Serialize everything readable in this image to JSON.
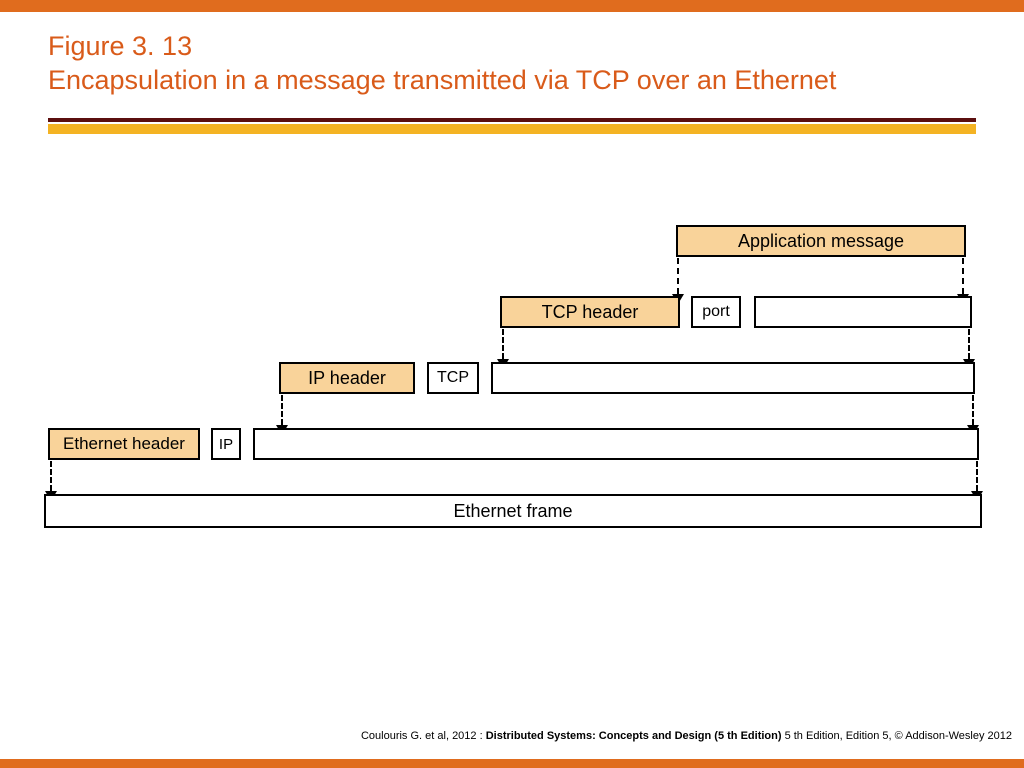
{
  "title_line1": "Figure 3. 13",
  "title_line2": "Encapsulation in a message transmitted via TCP over an Ethernet",
  "diagram": {
    "app_message": "Application message",
    "tcp_header": "TCP header",
    "port": "port",
    "ip_header": "IP header",
    "tcp_tag": "TCP",
    "ethernet_header": "Ethernet header",
    "ip_tag": "IP",
    "ethernet_frame": "Ethernet frame"
  },
  "footer": {
    "prefix": "Coulouris G. et al, 2012 : ",
    "bold": "Distributed Systems: Concepts and Design (5 th Edition)",
    "suffix": " 5 th Edition, Edition 5, © Addison-Wesley 2012"
  }
}
